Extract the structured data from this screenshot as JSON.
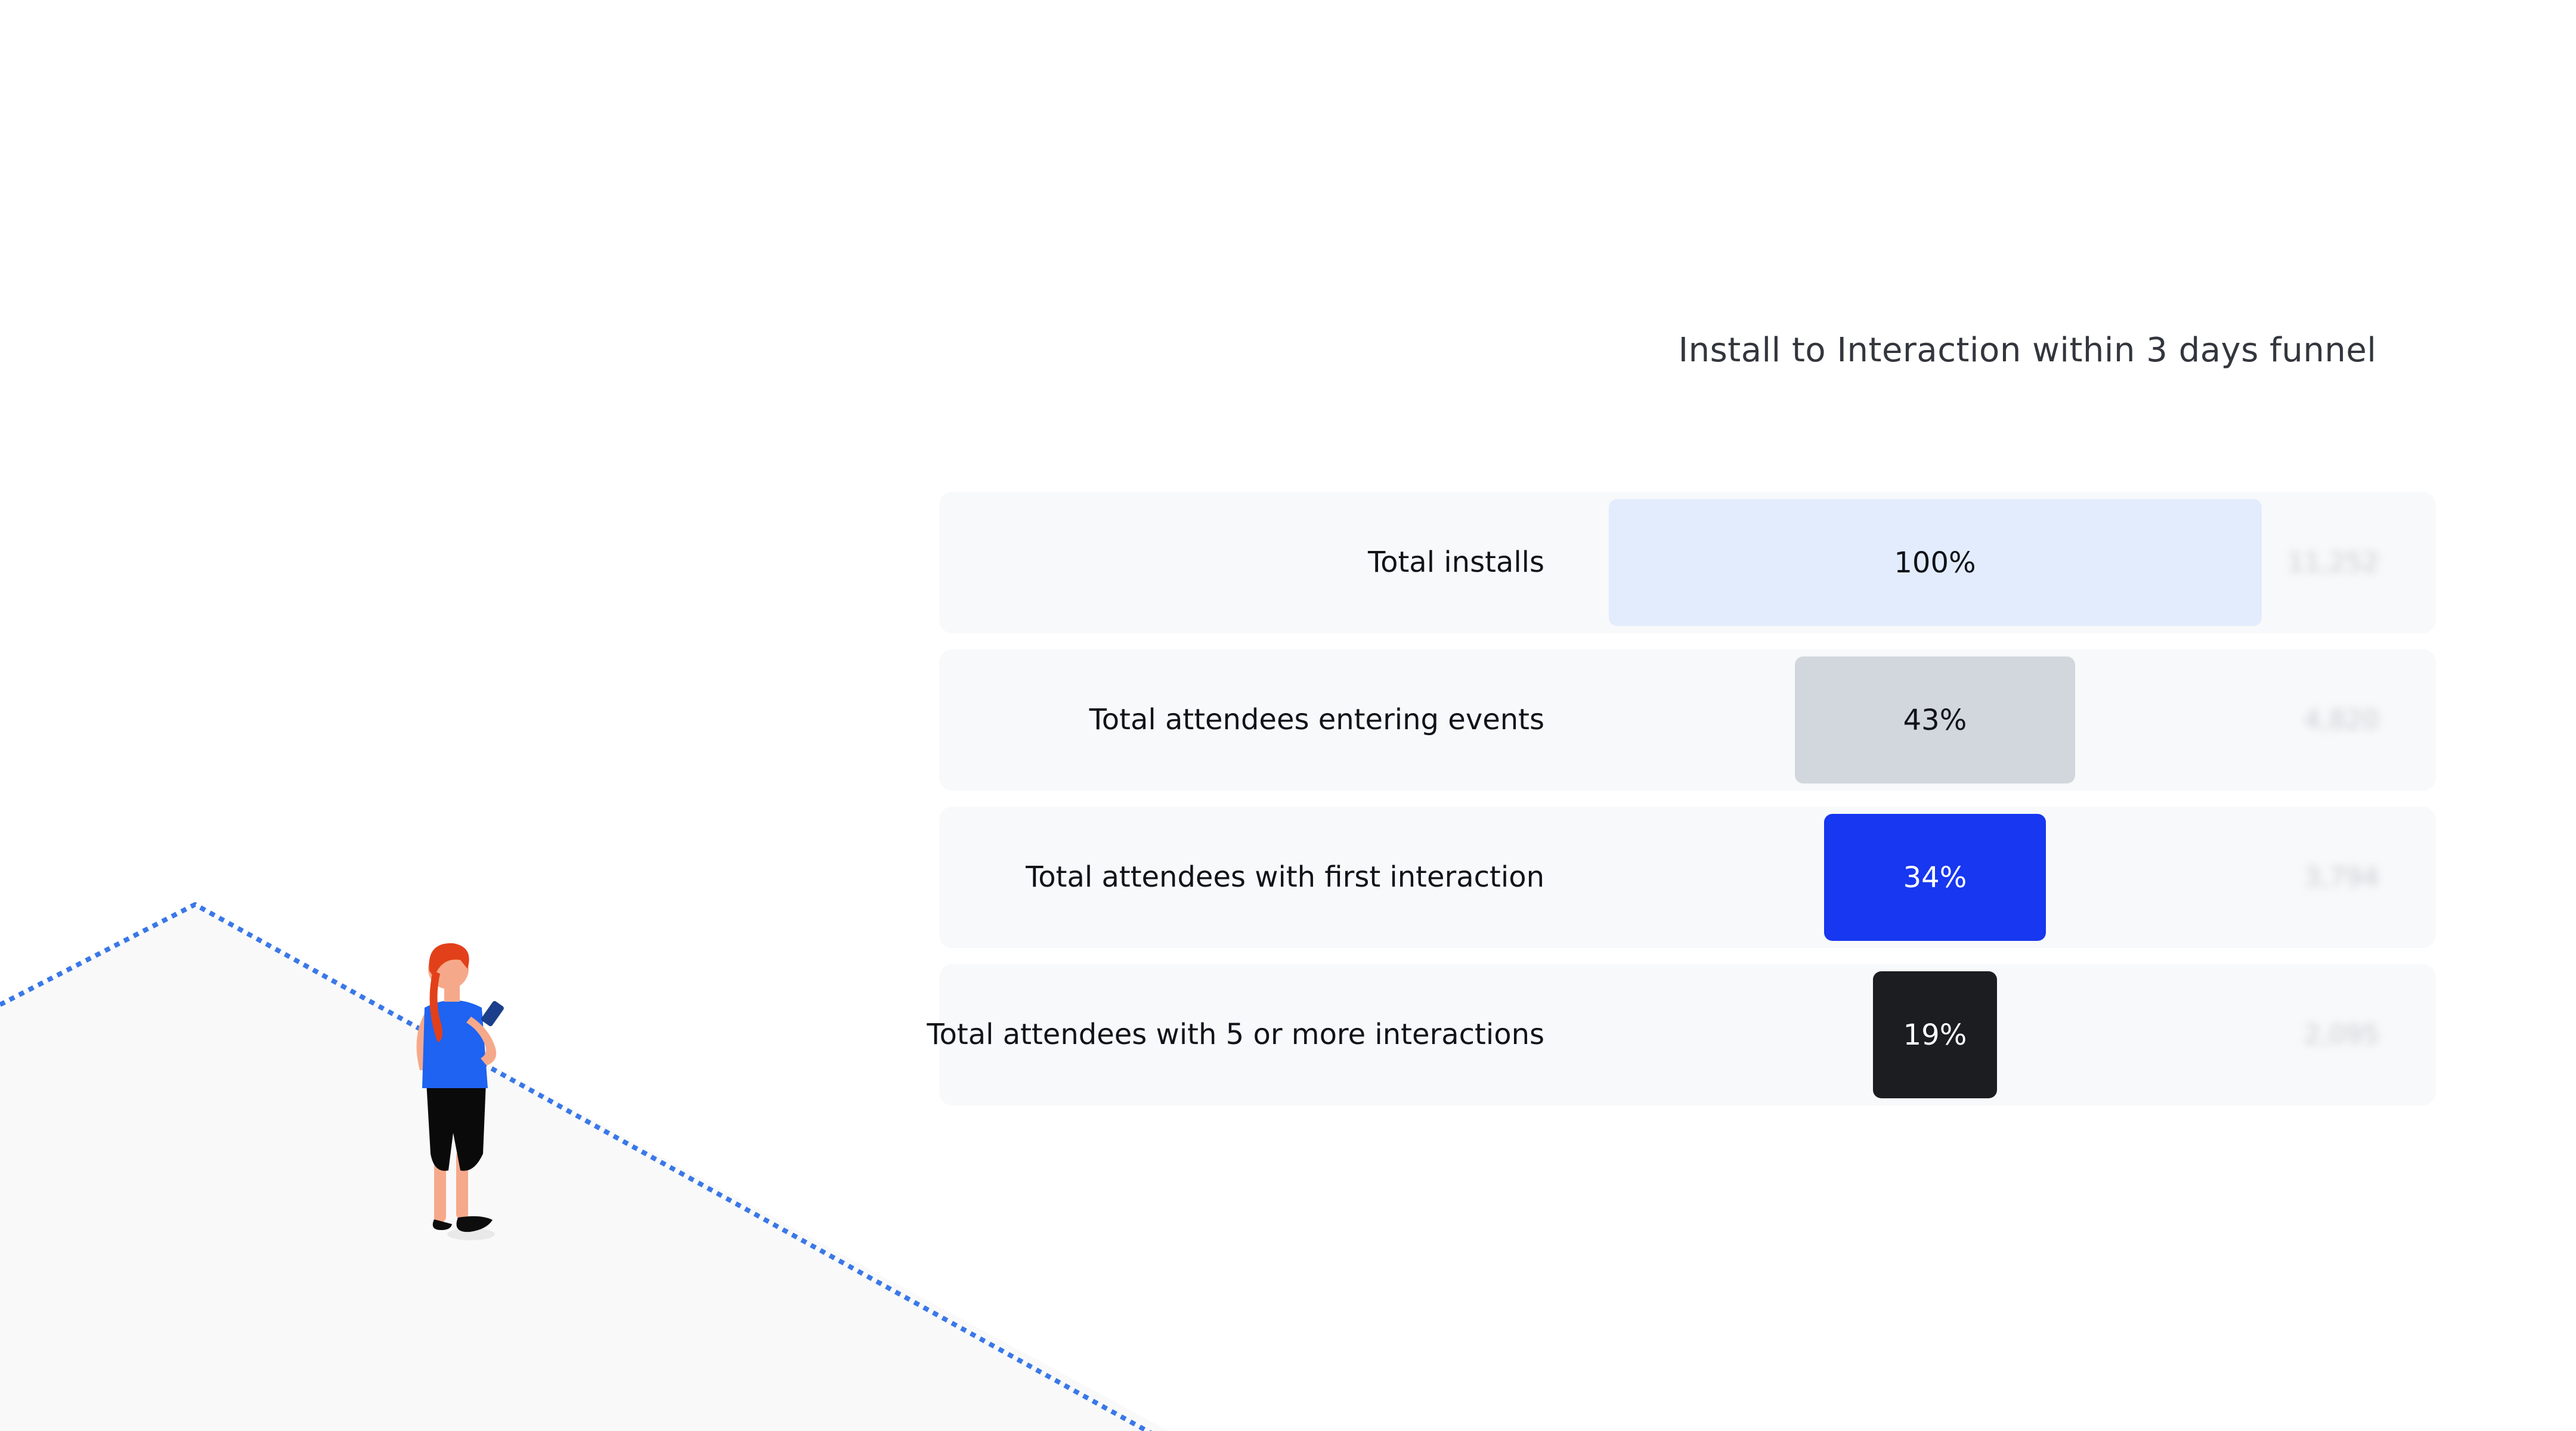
{
  "colors": {
    "background": "#ffffff",
    "row_bg": "#f8f9fa",
    "path_dots": "#3a78e8",
    "ground": "#f9f9f9"
  },
  "chart_data": {
    "type": "funnel",
    "title": "Install to Interaction within 3 days funnel",
    "stages": [
      {
        "label": "Total installs",
        "percent": 100,
        "percent_label": "100%",
        "count": "11,252",
        "bar_color": "#e3ecfd",
        "text_color": "#111319"
      },
      {
        "label": "Total attendees entering events",
        "percent": 43,
        "percent_label": "43%",
        "count": "4,820",
        "bar_color": "#d1d7dc",
        "text_color": "#111319"
      },
      {
        "label": "Total attendees with first interaction",
        "percent": 34,
        "percent_label": "34%",
        "count": "3,794",
        "bar_color": "#1737f0",
        "text_color": "#ffffff"
      },
      {
        "label": "Total attendees with 5 or more interactions",
        "percent": 19,
        "percent_label": "19%",
        "count": "2,095",
        "bar_color": "#1c1d21",
        "text_color": "#ffffff"
      }
    ]
  },
  "illustration": {
    "icon": "woman-with-phone-icon"
  }
}
